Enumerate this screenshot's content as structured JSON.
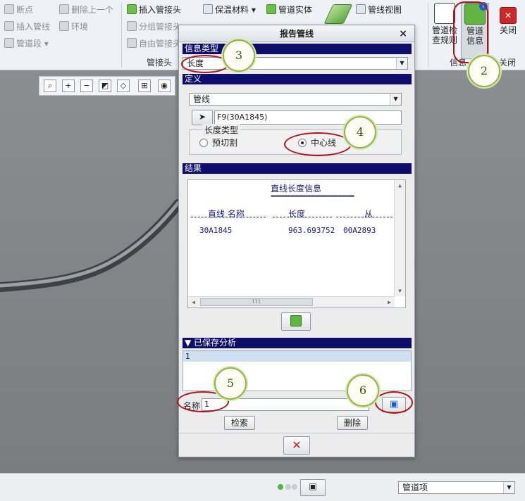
{
  "ribbon": {
    "col1": [
      "断点",
      "插入管线",
      "管道段"
    ],
    "col2": [
      "删除上一个",
      "环境"
    ],
    "col3": [
      "插入管接头",
      "分组管接头",
      "自由管接头"
    ],
    "col4": [
      "保温材料",
      "管道实体"
    ],
    "col5": [
      "管线视图"
    ],
    "groups": {
      "fitting": "管接头",
      "info": "信息",
      "close": "关闭"
    },
    "big_buttons": {
      "check": "管道检\n查规则",
      "info": "管道\n信息",
      "close": "关闭"
    }
  },
  "dialog": {
    "title": "报告管线",
    "sections": {
      "info_type": "信息类型",
      "definition": "定义",
      "results": "结果",
      "saved": "已保存分析"
    },
    "info_type_value": "长度",
    "definition_combo": "管线",
    "selection_field": "F9(30A1845)",
    "length_type": {
      "label": "长度类型",
      "options": [
        {
          "label": "预切割",
          "selected": false
        },
        {
          "label": "中心线",
          "selected": true
        }
      ]
    },
    "results": {
      "heading": "直线长度信息",
      "underline": "=====================",
      "columns": [
        "直线  名称",
        "长度",
        "从"
      ],
      "rows": [
        [
          "30A1845",
          "963.693752",
          "00A2893"
        ]
      ],
      "scroll_thumb": "lll"
    },
    "saved_items": [
      "1"
    ],
    "name_label": "名称",
    "name_value": "1",
    "retrieve": "检索",
    "delete": "删除"
  },
  "callouts": [
    "2",
    "3",
    "4",
    "5",
    "6"
  ],
  "status": {
    "filter": "管道项"
  },
  "colors": {
    "section_bar": "#0d0d6b",
    "annotation": "#b3121b",
    "callout_border": "#8fb44a"
  }
}
